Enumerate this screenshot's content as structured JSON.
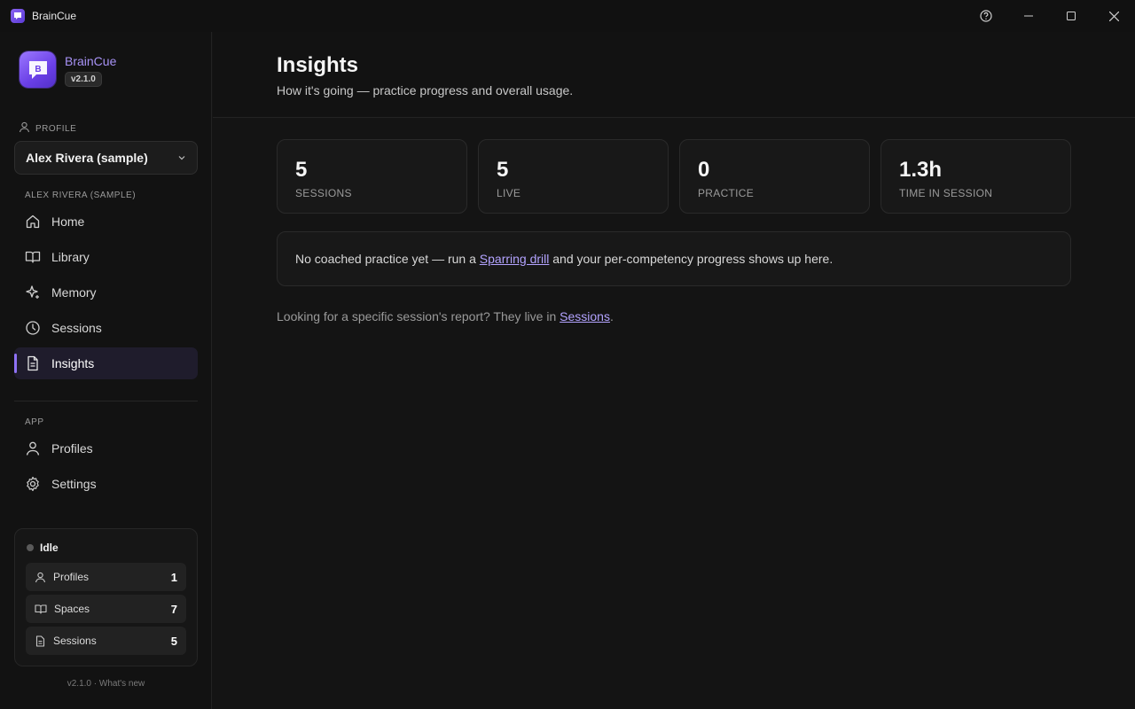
{
  "titlebar": {
    "app_name": "BrainCue"
  },
  "brand": {
    "name": "BrainCue",
    "version": "v2.1.0",
    "logo_letter": "B"
  },
  "profile": {
    "section_label": "PROFILE",
    "selected": "Alex Rivera (sample)"
  },
  "nav": {
    "section_label": "ALEX RIVERA (SAMPLE)",
    "items": [
      {
        "label": "Home",
        "icon": "home-icon"
      },
      {
        "label": "Library",
        "icon": "book-icon"
      },
      {
        "label": "Memory",
        "icon": "sparkle-icon"
      },
      {
        "label": "Sessions",
        "icon": "clock-icon"
      },
      {
        "label": "Insights",
        "icon": "document-icon",
        "active": true
      }
    ]
  },
  "app_nav": {
    "section_label": "APP",
    "items": [
      {
        "label": "Profiles",
        "icon": "user-icon"
      },
      {
        "label": "Settings",
        "icon": "gear-icon"
      }
    ]
  },
  "status": {
    "state": "Idle",
    "rows": [
      {
        "label": "Profiles",
        "count": "1",
        "icon": "user-icon"
      },
      {
        "label": "Spaces",
        "count": "7",
        "icon": "book-icon"
      },
      {
        "label": "Sessions",
        "count": "5",
        "icon": "document-icon"
      }
    ]
  },
  "footer": {
    "text": "v2.1.0 · What's new"
  },
  "page": {
    "title": "Insights",
    "subtitle": "How it's going — practice progress and overall usage."
  },
  "metrics": [
    {
      "value": "5",
      "caption": "SESSIONS"
    },
    {
      "value": "5",
      "caption": "LIVE"
    },
    {
      "value": "0",
      "caption": "PRACTICE"
    },
    {
      "value": "1.3h",
      "caption": "TIME IN SESSION"
    }
  ],
  "notice": {
    "before": "No coached practice yet — run a ",
    "link": "Sparring drill",
    "after": " and your per-competency progress shows up here."
  },
  "hint": {
    "before": "Looking for a specific session's report? They live in ",
    "link": "Sessions",
    "after": "."
  },
  "colors": {
    "accent": "#8f72f5",
    "link": "#b3a3ff",
    "background": "#141414"
  }
}
